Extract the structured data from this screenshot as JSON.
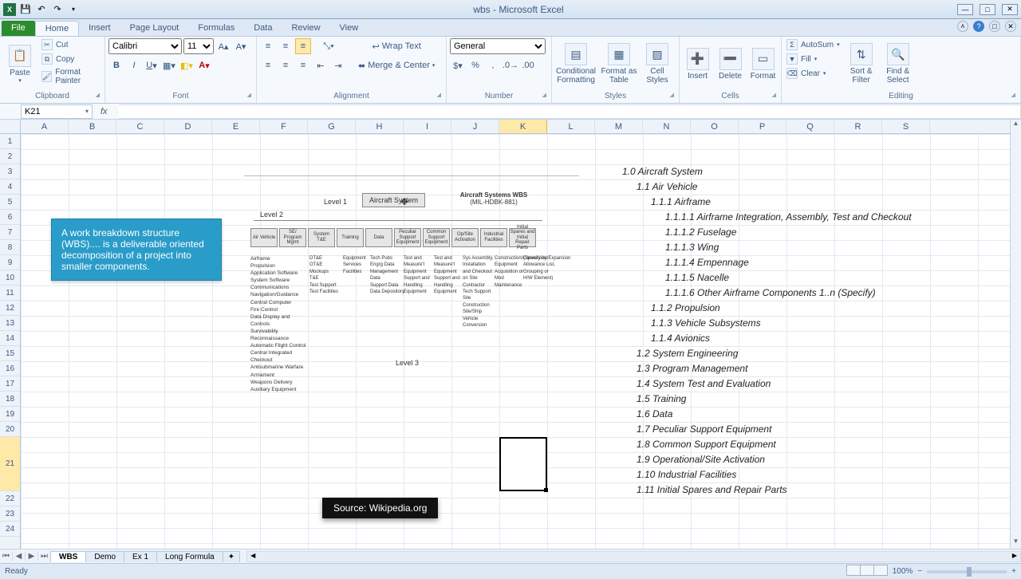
{
  "app": {
    "title": "wbs - Microsoft Excel"
  },
  "qat": {
    "save": "💾",
    "undo": "↶",
    "redo": "↷"
  },
  "tabs": [
    "File",
    "Home",
    "Insert",
    "Page Layout",
    "Formulas",
    "Data",
    "Review",
    "View"
  ],
  "activeTab": 1,
  "ribbon": {
    "clipboard": {
      "paste": "Paste",
      "cut": "Cut",
      "copy": "Copy",
      "painter": "Format Painter",
      "label": "Clipboard"
    },
    "font": {
      "name": "Calibri",
      "size": "11",
      "label": "Font"
    },
    "alignment": {
      "wrap": "Wrap Text",
      "merge": "Merge & Center",
      "label": "Alignment"
    },
    "number": {
      "format": "General",
      "label": "Number"
    },
    "styles": {
      "cond": "Conditional Formatting",
      "table": "Format as Table",
      "cell": "Cell Styles",
      "label": "Styles"
    },
    "cells": {
      "insert": "Insert",
      "delete": "Delete",
      "format": "Format",
      "label": "Cells"
    },
    "editing": {
      "autosum": "AutoSum",
      "fill": "Fill",
      "clear": "Clear",
      "sort": "Sort & Filter",
      "find": "Find & Select",
      "label": "Editing"
    }
  },
  "namebox": "K21",
  "columns": [
    "A",
    "B",
    "C",
    "D",
    "E",
    "F",
    "G",
    "H",
    "I",
    "J",
    "K",
    "L",
    "M",
    "N",
    "O",
    "P",
    "Q",
    "R",
    "S"
  ],
  "selectedCol": "K",
  "rows": [
    1,
    2,
    3,
    4,
    5,
    6,
    7,
    8,
    9,
    10,
    11,
    12,
    13,
    14,
    15,
    16,
    17,
    18,
    19,
    20,
    21,
    22,
    23,
    24
  ],
  "selectedRow": 21,
  "callout": "A work breakdown structure (WBS).... is a deliverable oriented decomposition of a project into smaller components.",
  "source": "Source: Wikipedia.org",
  "diagram": {
    "level1": "Level 1",
    "level2": "Level 2",
    "level3": "Level 3",
    "root": "Aircraft System",
    "wbsTitle": "Aircraft Systems WBS",
    "wbsSub": "(MIL-HDBK-881)",
    "boxes": [
      "Air Vehicle",
      "SE/ Program Mgmt",
      "System T&E",
      "Training",
      "Data",
      "Peculiar Support Equipment",
      "Common Support Equipment",
      "Op/Site Activation",
      "Industrial Facilities",
      "Initial Spares and Initial Repair Parts"
    ],
    "col1": [
      "Airframe",
      "Propulsion",
      "Application Software",
      "System Software",
      "Communications",
      "Navigation/Guidance",
      "Central Computer",
      "Fire Control",
      "Data Display and Controls",
      "Survivability",
      "Reconnaissance",
      "Automatic Flight Control",
      "Central Integrated Checkout",
      "Antisubmarine Warfare",
      "Armament",
      "Weapons Delivery",
      "Auxiliary Equipment"
    ],
    "col2a": [
      "DT&E",
      "OT&E",
      "Mockups",
      "T&E",
      "Test Support",
      "Test Facilities"
    ],
    "col2b": [
      "Equipment",
      "Services",
      "Facilities"
    ],
    "col2c": [
      "Tech Pubs",
      "Engrg Data",
      "Management Data",
      "Support Data",
      "Data Depository"
    ],
    "col2d": [
      "Test and Measure't Equipment",
      "Support and Handling Equipment"
    ],
    "col2e": [
      "Test and Measure't Equipment",
      "Support and Handling Equipment"
    ],
    "col2f": [
      "Sys Assembly, Installation and Checkout on Site",
      "Contractor Tech Support",
      "Site Construction",
      "Site/Ship Vehicle Conversion"
    ],
    "col2g": [
      "Construction/Conversion/Expansion",
      "Equipment Acquisition or Mod",
      "Maintenance"
    ],
    "col2h": [
      "(Specify by Allowance List, Grouping or H/W Element)"
    ]
  },
  "outline": [
    {
      "indent": 0,
      "text": "1.0 Aircraft System"
    },
    {
      "indent": 1,
      "text": "1.1 Air Vehicle"
    },
    {
      "indent": 2,
      "text": "1.1.1 Airframe"
    },
    {
      "indent": 3,
      "text": "1.1.1.1 Airframe Integration, Assembly, Test and Checkout"
    },
    {
      "indent": 3,
      "text": "1.1.1.2 Fuselage"
    },
    {
      "indent": 3,
      "text": "1.1.1.3 Wing"
    },
    {
      "indent": 3,
      "text": "1.1.1.4 Empennage"
    },
    {
      "indent": 3,
      "text": "1.1.1.5 Nacelle"
    },
    {
      "indent": 3,
      "text": "1.1.1.6 Other Airframe Components 1..n (Specify)"
    },
    {
      "indent": 2,
      "text": "1.1.2 Propulsion"
    },
    {
      "indent": 2,
      "text": "1.1.3 Vehicle Subsystems"
    },
    {
      "indent": 2,
      "text": "1.1.4 Avionics"
    },
    {
      "indent": 1,
      "text": "1.2 System Engineering"
    },
    {
      "indent": 1,
      "text": "1.3 Program Management"
    },
    {
      "indent": 1,
      "text": "1.4 System Test and Evaluation"
    },
    {
      "indent": 1,
      "text": "1.5 Training"
    },
    {
      "indent": 1,
      "text": "1.6 Data"
    },
    {
      "indent": 1,
      "text": "1.7 Peculiar Support Equipment"
    },
    {
      "indent": 1,
      "text": "1.8 Common Support Equipment"
    },
    {
      "indent": 1,
      "text": "1.9 Operational/Site Activation"
    },
    {
      "indent": 1,
      "text": "1.10 Industrial Facilities"
    },
    {
      "indent": 1,
      "text": "1.11 Initial Spares and Repair Parts"
    }
  ],
  "sheets": [
    "WBS",
    "Demo",
    "Ex 1",
    "Long Formula"
  ],
  "activeSheet": 0,
  "status": {
    "ready": "Ready",
    "zoom": "100%"
  }
}
